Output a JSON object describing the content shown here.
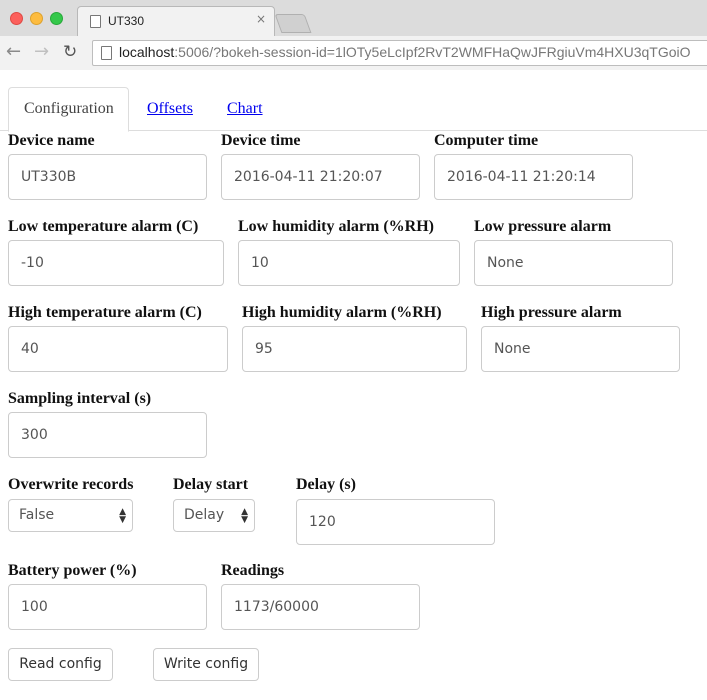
{
  "browser": {
    "tab_title": "UT330",
    "tab_close": "×",
    "url_host": "localhost",
    "url_rest": ":5006/?bokeh-session-id=1lOTy5eLcIpf2RvT2WMFHaQwJFRgiuVm4HXU3qTGoiO"
  },
  "tabs": [
    {
      "label": "Configuration",
      "active": true
    },
    {
      "label": "Offsets",
      "active": false
    },
    {
      "label": "Chart",
      "active": false
    }
  ],
  "form": {
    "device_name": {
      "label": "Device name",
      "value": "UT330B"
    },
    "device_time": {
      "label": "Device time",
      "value": "2016-04-11 21:20:07"
    },
    "computer_time": {
      "label": "Computer time",
      "value": "2016-04-11 21:20:14"
    },
    "low_temp": {
      "label": "Low temperature alarm (C)",
      "value": "-10"
    },
    "low_humidity": {
      "label": "Low humidity alarm (%RH)",
      "value": "10"
    },
    "low_pressure": {
      "label": "Low pressure alarm",
      "value": "None"
    },
    "high_temp": {
      "label": "High temperature alarm (C)",
      "value": "40"
    },
    "high_humidity": {
      "label": "High humidity alarm (%RH)",
      "value": "95"
    },
    "high_pressure": {
      "label": "High pressure alarm",
      "value": "None"
    },
    "sampling_interval": {
      "label": "Sampling interval (s)",
      "value": "300"
    },
    "overwrite": {
      "label": "Overwrite records",
      "selected": "False"
    },
    "delay_start": {
      "label": "Delay start",
      "selected": "Delay"
    },
    "delay": {
      "label": "Delay (s)",
      "value": "120"
    },
    "battery": {
      "label": "Battery power (%)",
      "value": "100"
    },
    "readings": {
      "label": "Readings",
      "value": "1173/60000"
    }
  },
  "buttons": {
    "read": "Read config",
    "write": "Write config"
  }
}
